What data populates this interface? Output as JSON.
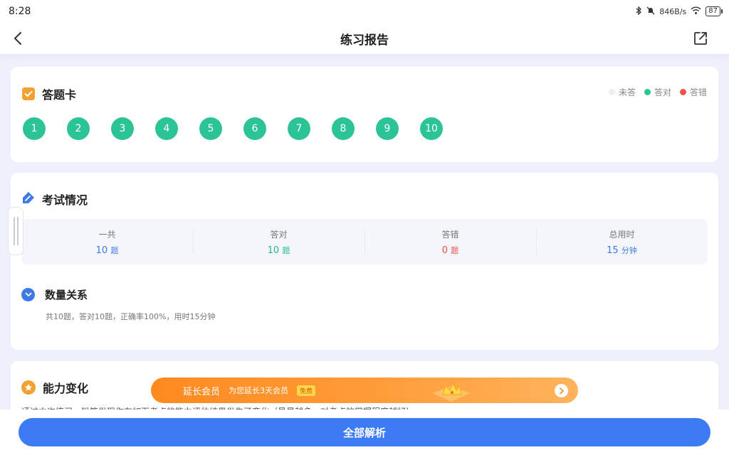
{
  "status_bar": {
    "time": "8:28",
    "network_speed": "846B/s",
    "battery": "87"
  },
  "header": {
    "title": "练习报告"
  },
  "answer_card": {
    "title": "答题卡",
    "legend": [
      {
        "label": "未答",
        "color": "#eef0f5"
      },
      {
        "label": "答对",
        "color": "#2cc496"
      },
      {
        "label": "答错",
        "color": "#f05252"
      }
    ],
    "questions": [
      "1",
      "2",
      "3",
      "4",
      "5",
      "6",
      "7",
      "8",
      "9",
      "10"
    ]
  },
  "exam": {
    "title": "考试情况",
    "stats": [
      {
        "label": "一共",
        "value": "10",
        "unit": "题"
      },
      {
        "label": "答对",
        "value": "10",
        "unit": "题"
      },
      {
        "label": "答错",
        "value": "0",
        "unit": "题"
      },
      {
        "label": "总用时",
        "value": "15",
        "unit": "分钟"
      }
    ],
    "section": {
      "title": "数量关系",
      "summary": "共10题，答对10题，正确率100%，用时15分钟"
    }
  },
  "ability": {
    "title": "能力变化",
    "description": "通过本次练习，粉笔发现你在如下考点的能力评估结果发生了变化（星星越多，对考点的掌握程度越好）"
  },
  "vip_banner": {
    "title": "延长会员",
    "subtitle": "为您延长3天会员",
    "badge": "免费"
  },
  "bottom": {
    "button_label": "全部解析"
  }
}
